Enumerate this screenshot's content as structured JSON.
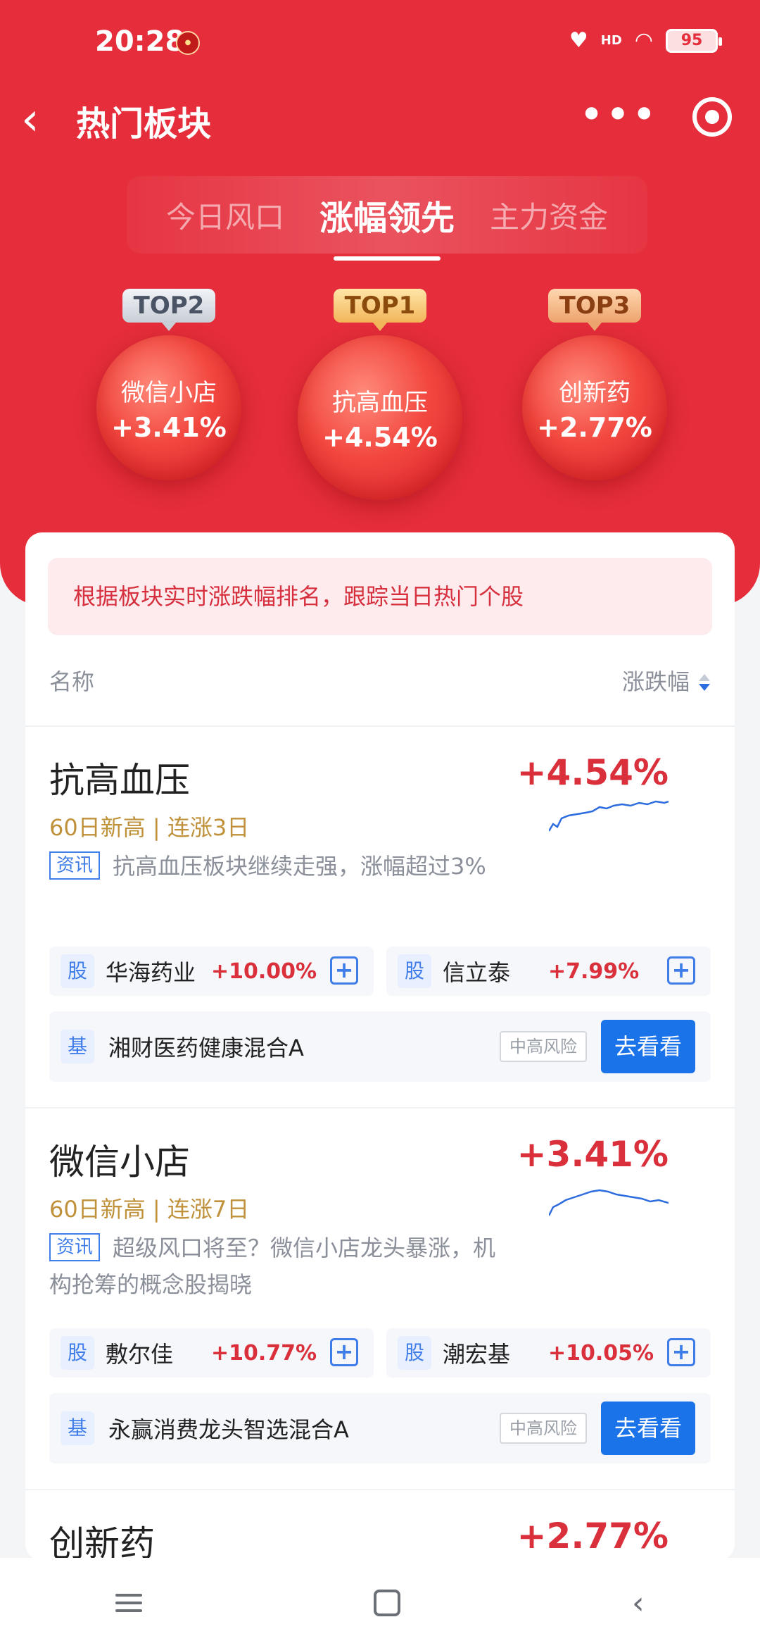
{
  "status_bar": {
    "time": "20:28",
    "signal": "HD",
    "battery": "95"
  },
  "nav": {
    "back": "‹",
    "title": "热门板块",
    "more": "•••"
  },
  "tabs": [
    {
      "label": "今日风口",
      "active": false
    },
    {
      "label": "涨幅领先",
      "active": true
    },
    {
      "label": "主力资金",
      "active": false
    }
  ],
  "top_bubbles": [
    {
      "rank": "TOP2",
      "name": "微信小店",
      "change": "+3.41%"
    },
    {
      "rank": "TOP1",
      "name": "抗高血压",
      "change": "+4.54%"
    },
    {
      "rank": "TOP3",
      "name": "创新药",
      "change": "+2.77%"
    }
  ],
  "notice": "根据板块实时涨跌幅排名，跟踪当日热门个股",
  "list_header": {
    "name_col": "名称",
    "change_col": "涨跌幅"
  },
  "sectors": [
    {
      "name": "抗高血压",
      "tags": "60日新高 | 连涨3日",
      "change": "+4.54%",
      "news_tag": "资讯",
      "news": "抗高血压板块继续走强，涨幅超过3%",
      "stocks": [
        {
          "tag": "股",
          "name": "华海药业",
          "change": "+10.00%"
        },
        {
          "tag": "股",
          "name": "信立泰",
          "change": "+7.99%"
        }
      ],
      "fund": {
        "tag": "基",
        "name": "湘财医药健康混合A",
        "risk": "中高风险",
        "action": "去看看"
      }
    },
    {
      "name": "微信小店",
      "tags": "60日新高 | 连涨7日",
      "change": "+3.41%",
      "news_tag": "资讯",
      "news": "超级风口将至？微信小店龙头暴涨，机构抢筹的概念股揭晓",
      "stocks": [
        {
          "tag": "股",
          "name": "敷尔佳",
          "change": "+10.77%"
        },
        {
          "tag": "股",
          "name": "潮宏基",
          "change": "+10.05%"
        }
      ],
      "fund": {
        "tag": "基",
        "name": "永赢消费龙头智选混合A",
        "risk": "中高风险",
        "action": "去看看"
      }
    },
    {
      "name": "创新药",
      "change": "+2.77%"
    }
  ],
  "colors": {
    "brand_red": "#e52d3b",
    "rise_red": "#d9303c",
    "action_blue": "#1a73e8",
    "tag_gold": "#c0913b"
  }
}
